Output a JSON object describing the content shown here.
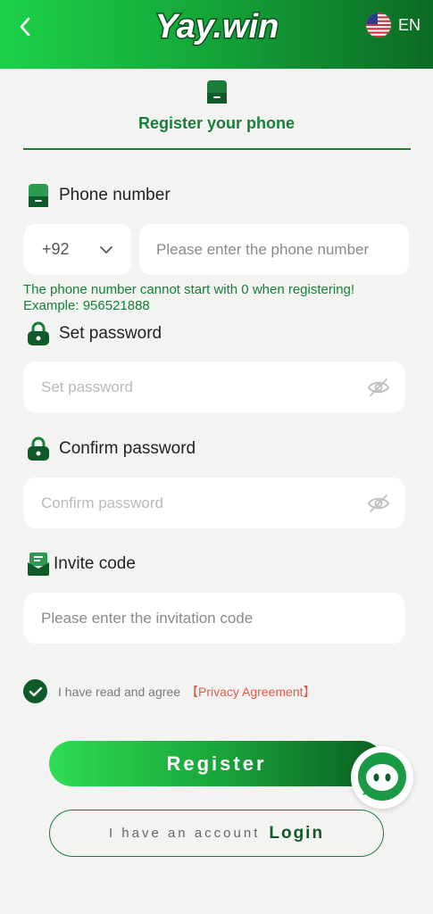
{
  "header": {
    "logo_text": "Yay.win",
    "language": "EN"
  },
  "page": {
    "title": "Register your phone"
  },
  "phone": {
    "label": "Phone number",
    "country_code": "+92",
    "placeholder": "Please enter the phone number",
    "hint_line1": "The phone number cannot start with 0 when registering!",
    "hint_line2": "Example: 956521888"
  },
  "password": {
    "label": "Set password",
    "placeholder": "Set password"
  },
  "confirm": {
    "label": "Confirm password",
    "placeholder": "Confirm password"
  },
  "invite": {
    "label": "Invite code",
    "placeholder": "Please enter the invitation code"
  },
  "agreement": {
    "text": "I have read and agree",
    "link": "【Privacy Agreement】",
    "checked": true
  },
  "actions": {
    "register": "Register",
    "login_prefix": "I have an account",
    "login": "Login"
  },
  "colors": {
    "brand_green": "#16803a",
    "dark_green": "#0f5a2b",
    "link_red": "#e05a4b"
  },
  "icons": {
    "back": "chevron-left-icon",
    "flag": "us-flag-icon",
    "phone": "phone-icon",
    "lock": "lock-icon",
    "invite": "invite-icon",
    "eye": "eye-off-icon",
    "check": "check-icon",
    "chat": "chat-icon"
  }
}
